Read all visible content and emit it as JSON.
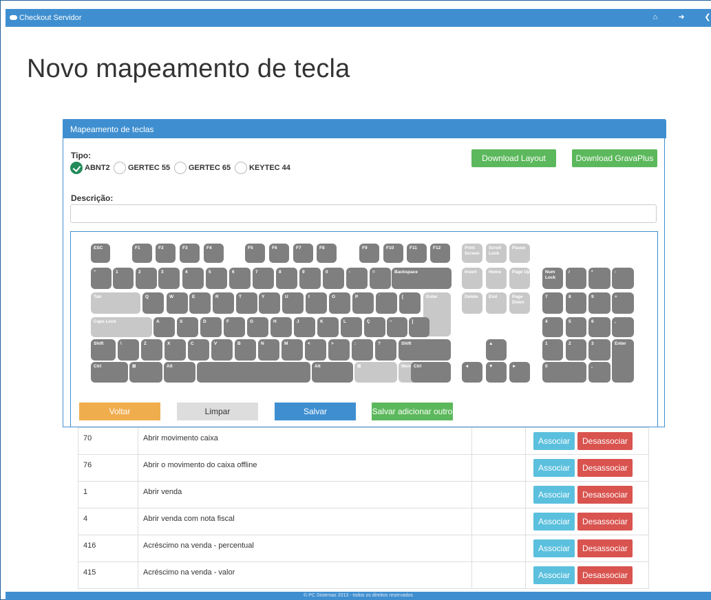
{
  "app": {
    "title": "Checkout Servidor"
  },
  "nav": {
    "icons": [
      "home-icon",
      "sign-out-icon",
      "back-icon"
    ]
  },
  "page": {
    "title": "Novo mapeamento de tecla"
  },
  "panel": {
    "heading": "Mapeamento de teclas"
  },
  "form": {
    "tipo_label": "Tipo:",
    "types": [
      {
        "label": "ABNT2",
        "checked": true
      },
      {
        "label": "GERTEC 55",
        "checked": false
      },
      {
        "label": "GERTEC 65",
        "checked": false
      },
      {
        "label": "KEYTEC 44",
        "checked": false
      }
    ],
    "descricao_label": "Descrição:",
    "descricao_value": "",
    "download_layout": "Download Layout",
    "download_gravaplus": "Download GravaPlus"
  },
  "keyboard": {
    "row_function": [
      "ESC",
      "F1",
      "F2",
      "F3",
      "F4",
      "F5",
      "F6",
      "F7",
      "F8",
      "F9",
      "F10",
      "F11",
      "F12",
      "Print Screen",
      "Scroll Lock",
      "Pause"
    ],
    "row_numbers": [
      "“",
      "1",
      "2",
      "3",
      "4",
      "5",
      "6",
      "7",
      "8",
      "9",
      "0",
      "-",
      "=",
      "Backspace",
      "Insert",
      "Home",
      "Page Up",
      "Num Lock",
      "/",
      "*",
      "-"
    ],
    "row_tab": [
      "Tab",
      "Q",
      "W",
      "E",
      "R",
      "T",
      "Y",
      "U",
      "I",
      "O",
      "P",
      "´",
      "[",
      "Enter",
      "Delete",
      "End",
      "Page Down",
      "7",
      "8",
      "9",
      "+"
    ],
    "row_caps": [
      "Caps Lock",
      "A",
      "S",
      "D",
      "F",
      "G",
      "H",
      "J",
      "K",
      "L",
      "Ç",
      "~",
      "]",
      "4",
      "5",
      "6",
      ","
    ],
    "row_shift": [
      "Shift",
      "\\",
      "Z",
      "X",
      "C",
      "V",
      "B",
      "N",
      "M",
      "<",
      ">",
      ":",
      "?",
      "Shift",
      "▲",
      "1",
      "2",
      "3",
      "Enter"
    ],
    "row_ctrl": [
      "Ctrl",
      "⊞",
      "Alt",
      "",
      "Alt",
      "⊞",
      "Menu",
      "Ctrl",
      "◄",
      "▼",
      "►",
      "0",
      ","
    ]
  },
  "actions": {
    "voltar": "Voltar",
    "limpar": "Limpar",
    "salvar": "Salvar",
    "salvar_outro": "Salvar adicionar outro"
  },
  "table": {
    "rows": [
      {
        "code": "70",
        "desc": "Abrir movimento caixa"
      },
      {
        "code": "76",
        "desc": "Abrir o movimento do caixa offline"
      },
      {
        "code": "1",
        "desc": "Abrir venda"
      },
      {
        "code": "4",
        "desc": "Abrir venda com nota fiscal"
      },
      {
        "code": "416",
        "desc": "Acréscimo na venda - percentual"
      },
      {
        "code": "415",
        "desc": "Acréscimo na venda - valor"
      }
    ],
    "associar": "Associar",
    "desassociar": "Desassociar"
  },
  "footer": {
    "text": "© PC Sistemas 2013 - todos os direitos reservados"
  },
  "colors": {
    "primary": "#3f8fd0",
    "success": "#5cb85c",
    "warning": "#f0ad4e",
    "danger": "#d9534f",
    "info": "#5bc0de"
  }
}
